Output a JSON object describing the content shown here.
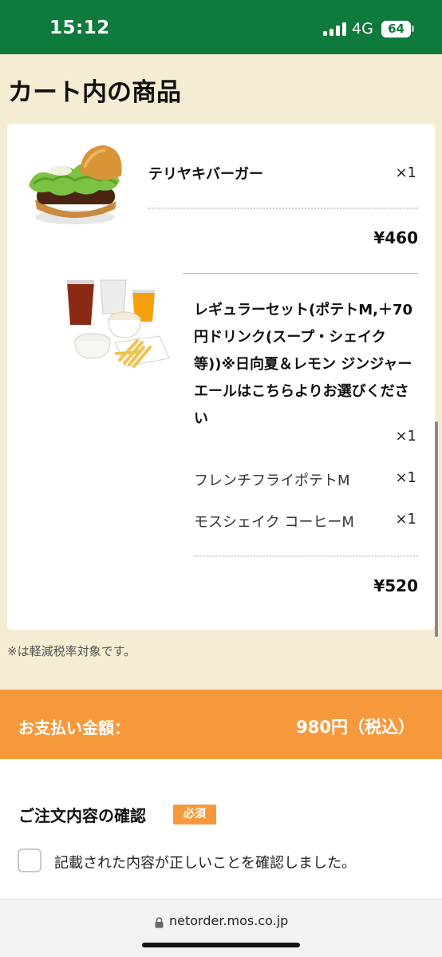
{
  "status_bar": {
    "time": "15:12",
    "network": "4G",
    "battery": "64"
  },
  "cart": {
    "title": "カート内の商品",
    "items": [
      {
        "name": "テリヤキバーガー",
        "quantity": "×1",
        "price": "¥460",
        "image": "teriyaki-burger-image"
      },
      {
        "name": "レギュラーセット(ポテトM,＋70円ドリンク(スープ・シェイク等))※日向夏＆レモン ジンジャーエールはこちらよりお選びください",
        "quantity": "×1",
        "price": "¥520",
        "image": "regular-set-image",
        "options": [
          {
            "name": "フレンチフライポテトM",
            "quantity": "×1"
          },
          {
            "name": "モスシェイク コーヒーM",
            "quantity": "×1"
          }
        ]
      }
    ],
    "tax_note": "※は軽減税率対象です。"
  },
  "payment": {
    "label": "お支払い金額：",
    "total": "980円（税込）"
  },
  "confirmation": {
    "title": "ご注文内容の確認",
    "required_badge": "必須",
    "checkbox_label": "記載された内容が正しいことを確認しました。",
    "checked": false
  },
  "browser": {
    "url": "netorder.mos.co.jp"
  },
  "colors": {
    "status_bar": "#0e7a3c",
    "page_background": "#f5ecd4",
    "accent_orange": "#f6993d",
    "card": "#ffffff"
  }
}
